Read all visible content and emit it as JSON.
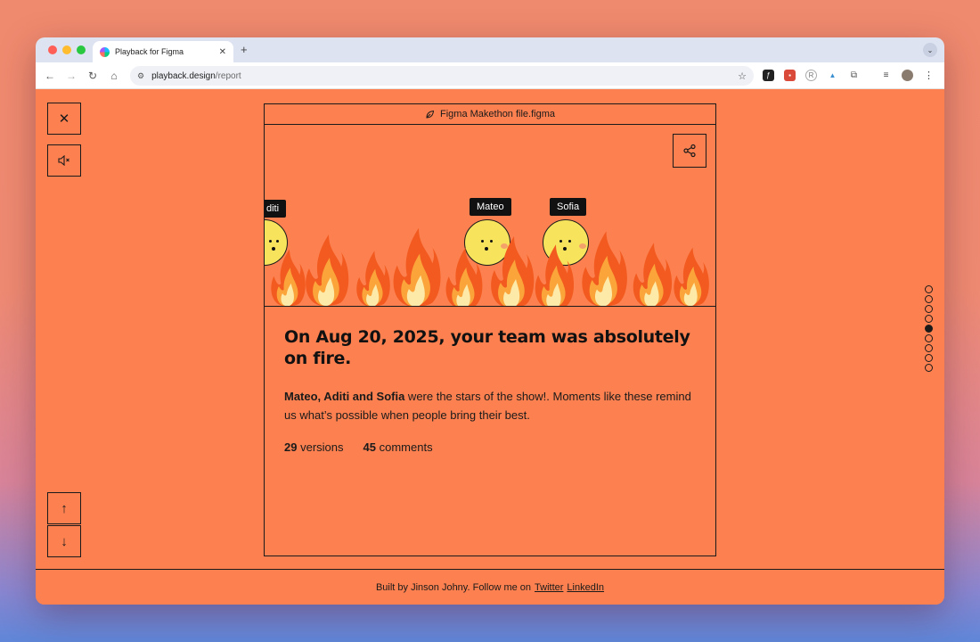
{
  "browser": {
    "tab_title": "Playback for Figma",
    "url_host": "playback.design",
    "url_path": "/report",
    "traffic_colors": [
      "#ff5f57",
      "#febc2e",
      "#28c840"
    ]
  },
  "sidebar": {
    "close_label": "✕",
    "mute_label": "🔇",
    "up_label": "↑",
    "down_label": "↓"
  },
  "card": {
    "file_name": "Figma Makethon file.figma",
    "nametags": [
      "diti",
      "Mateo",
      "Sofia"
    ],
    "headline": "On Aug 20, 2025, your team was absolutely on fire.",
    "stars": "Mateo, Aditi and Sofia",
    "body": " were the stars of the show!. Moments like these remind us what’s possible when people bring their best.",
    "versions_count": "29",
    "versions_label": "versions",
    "comments_count": "45",
    "comments_label": "comments"
  },
  "pager": {
    "total": 9,
    "active": 4
  },
  "footer": {
    "text": "Built by Jinson Johny. Follow me on",
    "twitter": "Twitter",
    "linkedin": "LinkedIn"
  },
  "colors": {
    "page_bg": "#fd8150",
    "ink": "#1a1a1a",
    "face": "#f7e45c"
  }
}
